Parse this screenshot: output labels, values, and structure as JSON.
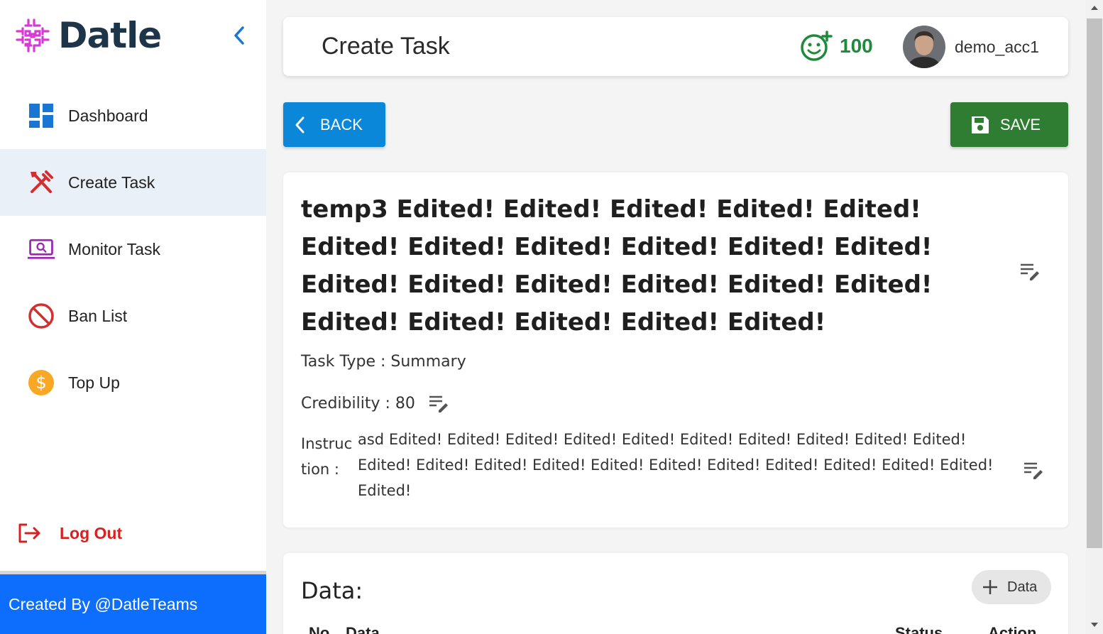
{
  "app": {
    "logo_text": "Datle",
    "footer_text": "Created By @DatleTeams"
  },
  "sidebar": {
    "items": [
      {
        "label": "Dashboard",
        "icon": "dashboard-icon",
        "active": false
      },
      {
        "label": "Create Task",
        "icon": "tools-icon",
        "active": true
      },
      {
        "label": "Monitor Task",
        "icon": "monitor-icon",
        "active": false
      },
      {
        "label": "Ban List",
        "icon": "ban-icon",
        "active": false
      },
      {
        "label": "Top Up",
        "icon": "dollar-icon",
        "active": false
      }
    ],
    "logout_label": "Log Out"
  },
  "header": {
    "title": "Create Task",
    "credit_value": "100",
    "username": "demo_acc1"
  },
  "toolbar": {
    "back_label": "BACK",
    "save_label": "SAVE"
  },
  "task": {
    "title": "temp3 Edited! Edited! Edited! Edited! Edited! Edited! Edited! Edited! Edited! Edited! Edited! Edited! Edited! Edited! Edited! Edited! Edited! Edited! Edited! Edited! Edited! Edited!",
    "task_type": "Task Type : Summary",
    "credibility": "Credibility : 80",
    "instruction_label": "Instruction :",
    "instruction_text": "asd Edited! Edited! Edited! Edited! Edited! Edited! Edited! Edited! Edited! Edited! Edited! Edited! Edited! Edited! Edited! Edited! Edited! Edited! Edited! Edited! Edited! Edited!"
  },
  "data_section": {
    "title": "Data:",
    "add_label": "Data",
    "columns": [
      "No",
      "Data",
      "Status",
      "Action"
    ]
  },
  "colors": {
    "primary_blue": "#0a87d8",
    "save_green": "#2e7d32",
    "footer_blue": "#0d6efd",
    "logout_red": "#d92020",
    "credit_green": "#1f8a3a"
  }
}
